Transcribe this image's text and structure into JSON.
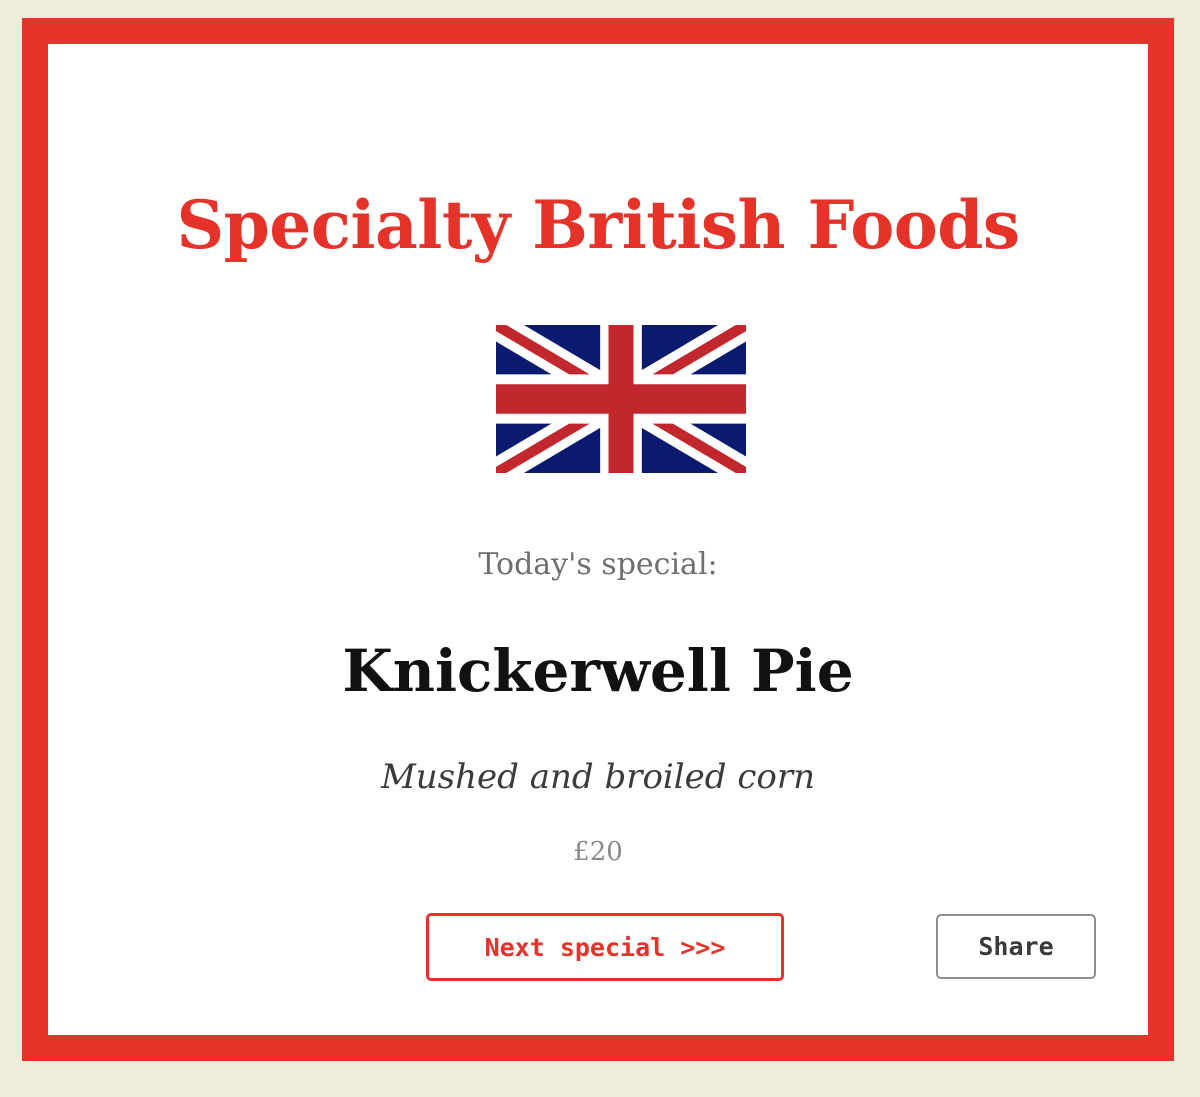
{
  "header": {
    "title": "Specialty British Foods"
  },
  "flag": {
    "icon": "union-jack-flag-icon",
    "colors": {
      "blue": "#0a1a6e",
      "red": "#c1272d",
      "white": "#ffffff"
    }
  },
  "special": {
    "label": "Today's special:",
    "name": "Knickerwell Pie",
    "description": "Mushed and broiled corn",
    "price": "£20"
  },
  "actions": {
    "next_label": "Next special >>>",
    "share_label": "Share"
  },
  "theme": {
    "accent": "#e63329",
    "background": "#f0ecda",
    "card": "#ffffff"
  }
}
